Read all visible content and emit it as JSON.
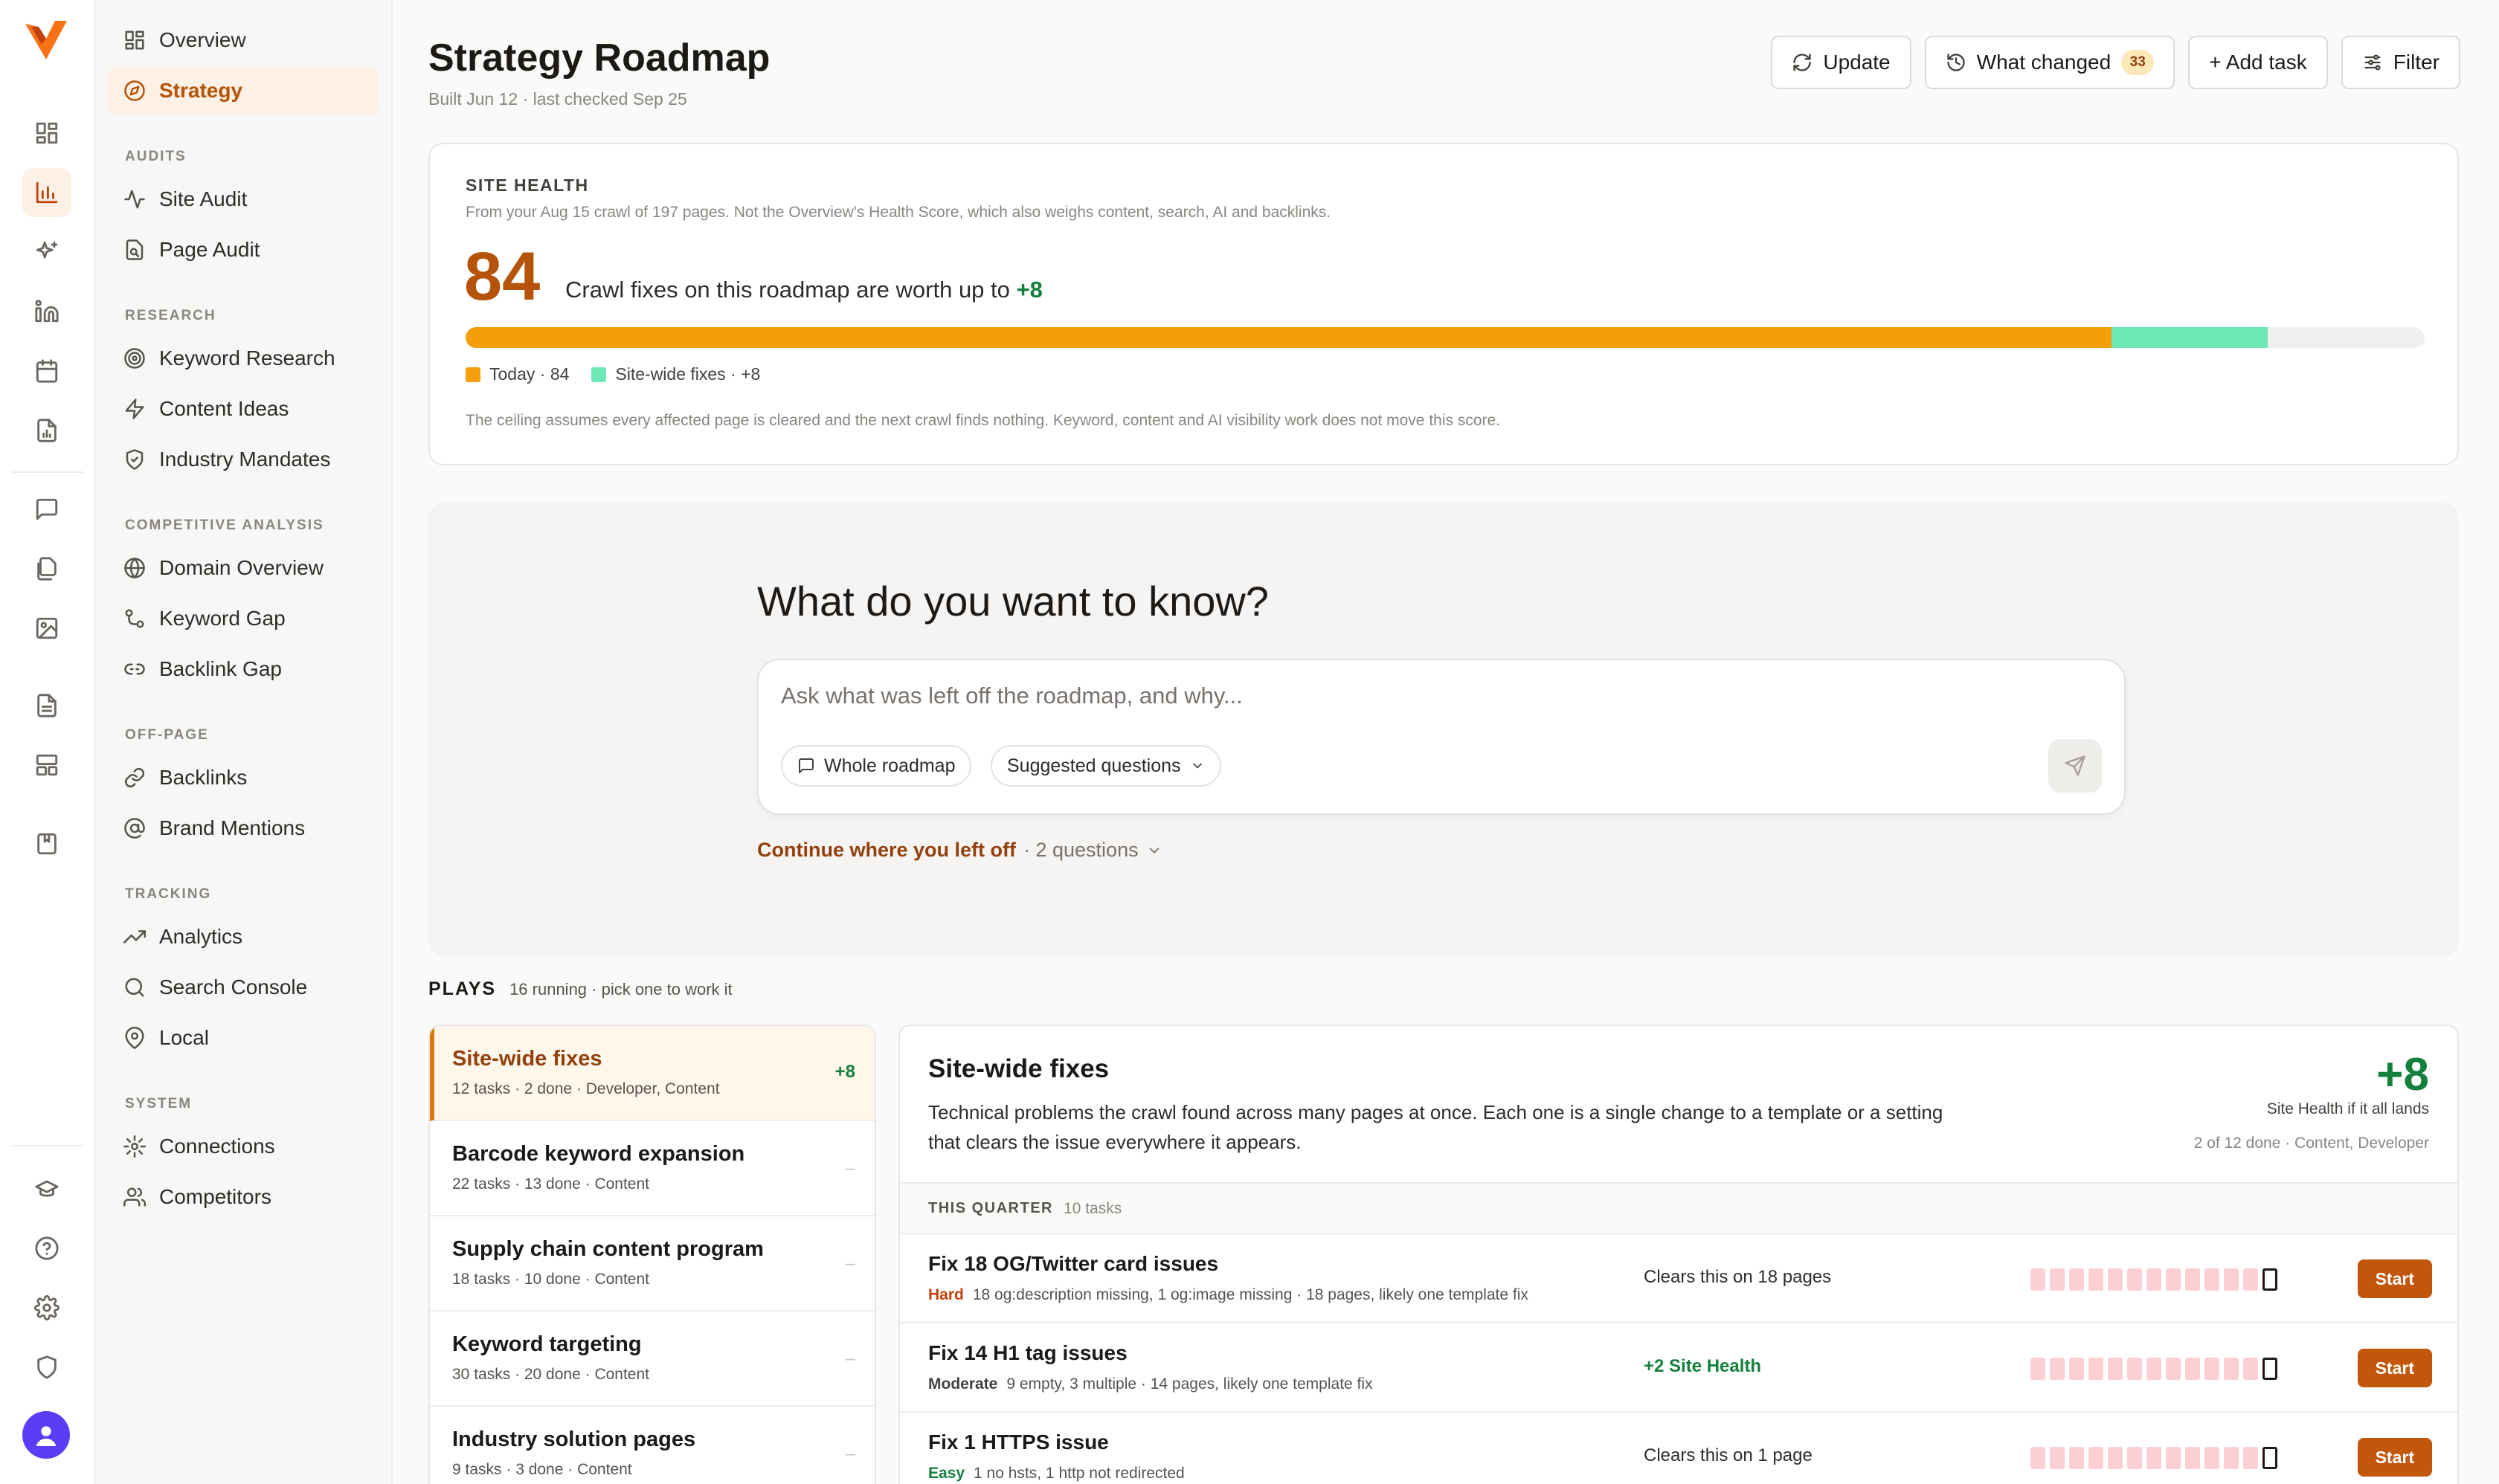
{
  "nav": {
    "top": [
      {
        "label": "Overview",
        "icon": "overview-icon"
      },
      {
        "label": "Strategy",
        "icon": "strategy-icon",
        "active": true
      }
    ],
    "sections": [
      {
        "title": "AUDITS",
        "items": [
          {
            "label": "Site Audit"
          },
          {
            "label": "Page Audit"
          }
        ]
      },
      {
        "title": "RESEARCH",
        "items": [
          {
            "label": "Keyword Research"
          },
          {
            "label": "Content Ideas"
          },
          {
            "label": "Industry Mandates"
          }
        ]
      },
      {
        "title": "COMPETITIVE ANALYSIS",
        "items": [
          {
            "label": "Domain Overview"
          },
          {
            "label": "Keyword Gap"
          },
          {
            "label": "Backlink Gap"
          }
        ]
      },
      {
        "title": "OFF-PAGE",
        "items": [
          {
            "label": "Backlinks"
          },
          {
            "label": "Brand Mentions"
          }
        ]
      },
      {
        "title": "TRACKING",
        "items": [
          {
            "label": "Analytics"
          },
          {
            "label": "Search Console"
          },
          {
            "label": "Local"
          }
        ]
      },
      {
        "title": "SYSTEM",
        "items": [
          {
            "label": "Connections"
          },
          {
            "label": "Competitors"
          }
        ]
      }
    ]
  },
  "header": {
    "title": "Strategy Roadmap",
    "subtitle": "Built Jun 12 · last checked Sep 25",
    "update_label": "Update",
    "what_changed_label": "What changed",
    "what_changed_count": "33",
    "add_task_label": "+ Add task",
    "filter_label": "Filter"
  },
  "health": {
    "label": "SITE HEALTH",
    "description": "From your Aug 15 crawl of 197 pages. Not the Overview's Health Score, which also weighs content, search, AI and backlinks.",
    "score": "84",
    "worth_text": "Crawl fixes on this roadmap are worth up to",
    "worth_value": "+8",
    "bar_today_fraction": 0.84,
    "bar_fixes_fraction": 0.08,
    "legend_today": "Today · 84",
    "legend_fixes": "Site-wide fixes · +8",
    "note": "The ceiling assumes every affected page is cleared and the next crawl finds nothing. Keyword, content and AI visibility work does not move this score.",
    "colors": {
      "today": "#f59e0b",
      "fixes": "#6ee7b7"
    }
  },
  "ask": {
    "title": "What do you want to know?",
    "placeholder": "Ask what was left off the roadmap, and why...",
    "scope_chip": "Whole roadmap",
    "suggested_chip": "Suggested questions",
    "continue_link": "Continue where you left off",
    "continue_count": "· 2 questions"
  },
  "plays": {
    "title": "PLAYS",
    "subtitle": "16 running · pick one to work it",
    "items": [
      {
        "name": "Site-wide fixes",
        "meta": "12 tasks · 2 done · Developer, Content",
        "value": "+8",
        "active": true
      },
      {
        "name": "Barcode keyword expansion",
        "meta": "22 tasks · 13 done · Content",
        "value": "–"
      },
      {
        "name": "Supply chain content program",
        "meta": "18 tasks · 10 done · Content",
        "value": "–"
      },
      {
        "name": "Keyword targeting",
        "meta": "30 tasks · 20 done · Content",
        "value": "–"
      },
      {
        "name": "Industry solution pages",
        "meta": "9 tasks · 3 done · Content",
        "value": "–"
      }
    ]
  },
  "detail": {
    "title": "Site-wide fixes",
    "description": "Technical problems the crawl found across many pages at once. Each one is a single change to a template or a setting that clears the issue everywhere it appears.",
    "value": "+8",
    "value_label": "Site Health if it all lands",
    "meta": "2 of 12 done · Content, Developer",
    "quarter_label": "THIS QUARTER",
    "quarter_count": "10 tasks",
    "start_label": "Start",
    "tasks": [
      {
        "name": "Fix 18 OG/Twitter card issues",
        "difficulty": "Hard",
        "difficulty_color": "#c2410c",
        "meta": "18 og:description missing, 1 og:image missing · 18 pages, likely one template fix",
        "impact": "Clears this on 18 pages",
        "impact_green": false
      },
      {
        "name": "Fix 14 H1 tag issues",
        "difficulty": "Moderate",
        "difficulty_color": "#44403c",
        "meta": "9 empty, 3 multiple · 14 pages, likely one template fix",
        "impact": "+2 Site Health",
        "impact_green": true
      },
      {
        "name": "Fix 1 HTTPS issue",
        "difficulty": "Easy",
        "difficulty_color": "#15803d",
        "meta": "1 no hsts, 1 http not redirected",
        "impact": "Clears this on 1 page",
        "impact_green": false
      }
    ]
  }
}
